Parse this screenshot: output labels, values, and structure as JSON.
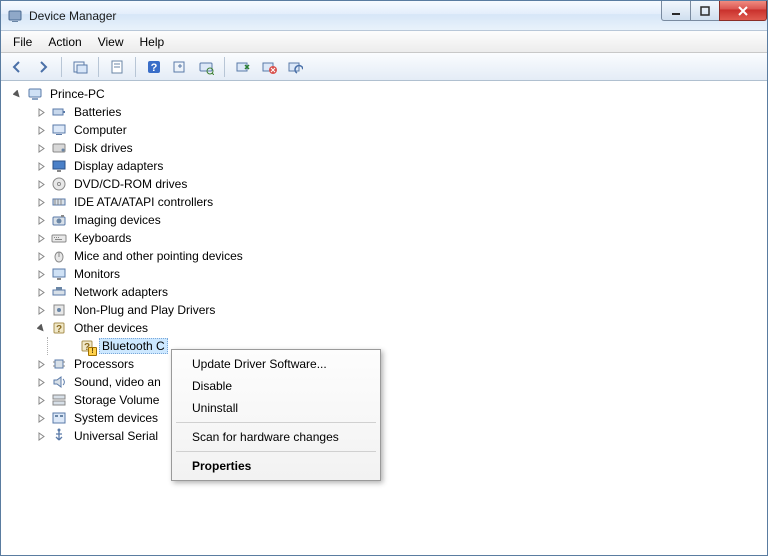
{
  "window": {
    "title": "Device Manager"
  },
  "menu": {
    "file": "File",
    "action": "Action",
    "view": "View",
    "help": "Help"
  },
  "toolbar": {
    "back": "back",
    "forward": "forward",
    "show_hidden": "show-hidden",
    "properties": "properties",
    "help": "help",
    "update": "update",
    "scan": "scan",
    "uninstall": "uninstall",
    "disable": "disable",
    "enable": "enable"
  },
  "tree": {
    "root": "Prince-PC",
    "items": [
      {
        "label": "Batteries",
        "icon": "battery-icon"
      },
      {
        "label": "Computer",
        "icon": "computer-icon"
      },
      {
        "label": "Disk drives",
        "icon": "disk-icon"
      },
      {
        "label": "Display adapters",
        "icon": "display-icon"
      },
      {
        "label": "DVD/CD-ROM drives",
        "icon": "dvd-icon"
      },
      {
        "label": "IDE ATA/ATAPI controllers",
        "icon": "ide-icon"
      },
      {
        "label": "Imaging devices",
        "icon": "camera-icon"
      },
      {
        "label": "Keyboards",
        "icon": "keyboard-icon"
      },
      {
        "label": "Mice and other pointing devices",
        "icon": "mouse-icon"
      },
      {
        "label": "Monitors",
        "icon": "monitor-icon"
      },
      {
        "label": "Network adapters",
        "icon": "network-icon"
      },
      {
        "label": "Non-Plug and Play Drivers",
        "icon": "driver-icon"
      },
      {
        "label": "Other devices",
        "icon": "other-icon",
        "expanded": true,
        "children": [
          {
            "label": "Bluetooth Controller",
            "icon": "unknown-device-icon",
            "warn": true,
            "selected": true,
            "truncated": "Bluetooth C"
          }
        ]
      },
      {
        "label": "Processors",
        "icon": "cpu-icon"
      },
      {
        "label": "Sound, video an",
        "icon": "sound-icon",
        "truncated": true
      },
      {
        "label": "Storage Volume",
        "icon": "storage-icon",
        "truncated": true
      },
      {
        "label": "System devices",
        "icon": "system-icon"
      },
      {
        "label": "Universal Serial ",
        "icon": "usb-icon",
        "truncated": true
      }
    ]
  },
  "context_menu": {
    "update": "Update Driver Software...",
    "disable": "Disable",
    "uninstall": "Uninstall",
    "scan": "Scan for hardware changes",
    "properties": "Properties"
  }
}
